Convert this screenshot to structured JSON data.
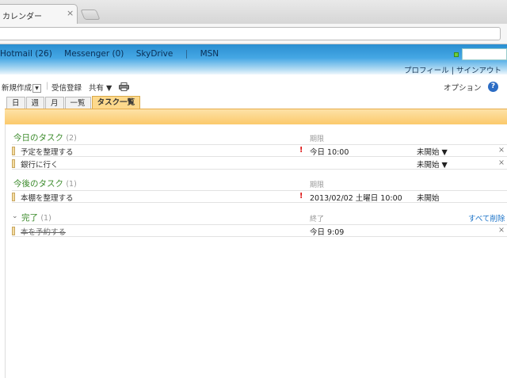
{
  "browser": {
    "tab_title": "カレンダー",
    "tab_close": "×"
  },
  "topnav": {
    "links": [
      "Hotmail (26)",
      "Messenger (0)",
      "SkyDrive",
      "MSN"
    ],
    "separator": "|",
    "account": "プロフィール | サインアウト"
  },
  "commands": {
    "new": "新規作成",
    "receive": "受信登録",
    "share": "共有 ▼",
    "options": "オプション",
    "help": "?"
  },
  "view_tabs": [
    "日",
    "週",
    "月",
    "一覧",
    "タスク一覧"
  ],
  "active_view": "タスク一覧",
  "sections": {
    "today": {
      "title": "今日のタスク",
      "count": "(2)",
      "column": "期限",
      "tasks": [
        {
          "name": "予定を整理する",
          "important": "!",
          "due": "今日 10:00",
          "status": "未開始 ▼",
          "delete": "×"
        },
        {
          "name": "銀行に行く",
          "important": "",
          "due": "",
          "status": "未開始 ▼",
          "delete": "×"
        }
      ]
    },
    "later": {
      "title": "今後のタスク",
      "count": "(1)",
      "column": "期限",
      "tasks": [
        {
          "name": "本棚を整理する",
          "important": "!",
          "due": "2013/02/02 土曜日 10:00",
          "status": "未開始",
          "delete": ""
        }
      ]
    },
    "done": {
      "chevron": "⌄",
      "title": "完了",
      "count": "(1)",
      "column": "終了",
      "clear_all": "すべて削除",
      "tasks": [
        {
          "name": "本を予約する",
          "due": "今日 9:09",
          "delete": "×"
        }
      ]
    }
  }
}
